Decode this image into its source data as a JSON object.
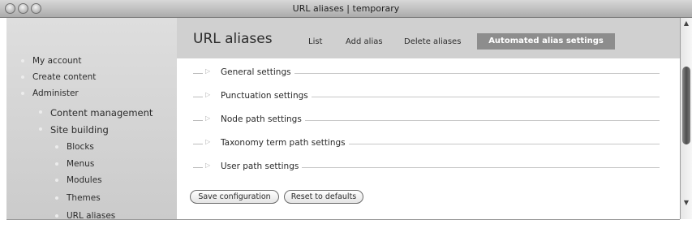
{
  "window": {
    "title": "URL aliases | temporary"
  },
  "sidebar": {
    "items": [
      {
        "label": "My account"
      },
      {
        "label": "Create content"
      },
      {
        "label": "Administer"
      },
      {
        "label": "Content management"
      },
      {
        "label": "Site building"
      },
      {
        "label": "Blocks"
      },
      {
        "label": "Menus"
      },
      {
        "label": "Modules"
      },
      {
        "label": "Themes"
      },
      {
        "label": "URL aliases"
      }
    ]
  },
  "main": {
    "title": "URL aliases",
    "tabs": [
      {
        "label": "List"
      },
      {
        "label": "Add alias"
      },
      {
        "label": "Delete aliases"
      },
      {
        "label": "Automated alias settings",
        "active": true
      }
    ],
    "sections": [
      {
        "label": "General settings"
      },
      {
        "label": "Punctuation settings"
      },
      {
        "label": "Node path settings"
      },
      {
        "label": "Taxonomy term path settings"
      },
      {
        "label": "User path settings"
      }
    ],
    "buttons": {
      "save": "Save configuration",
      "reset": "Reset to defaults"
    }
  },
  "icons": {
    "expand": "triangle-right-icon",
    "window_controls": [
      "close-icon",
      "minimize-icon",
      "zoom-icon"
    ]
  }
}
